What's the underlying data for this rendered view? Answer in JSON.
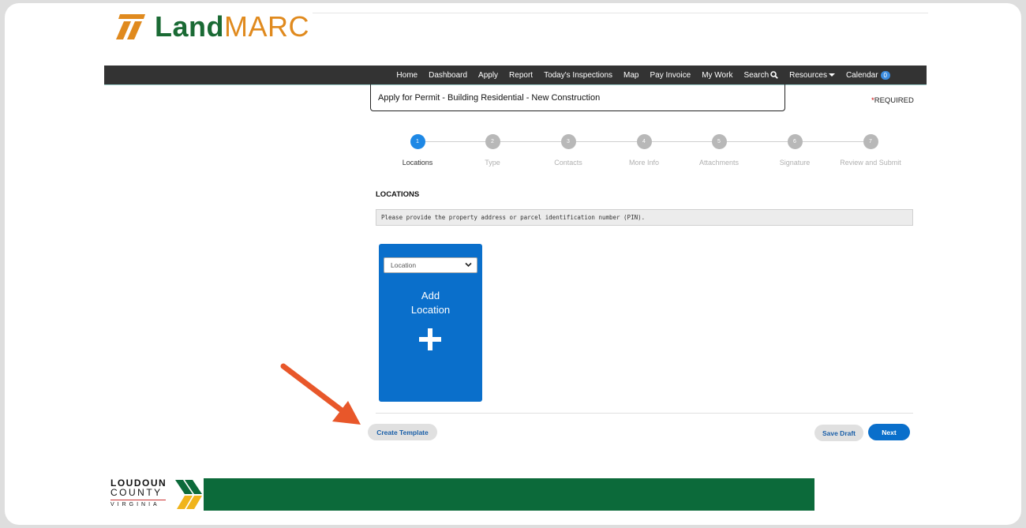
{
  "brand": {
    "name_part1": "Land",
    "name_part2": "MARC",
    "logo_icon": "landmarc-stripes-icon",
    "accent_green": "#1a6a34",
    "accent_orange": "#e08a1e"
  },
  "nav": {
    "items": [
      {
        "label": "Home"
      },
      {
        "label": "Dashboard"
      },
      {
        "label": "Apply"
      },
      {
        "label": "Report"
      },
      {
        "label": "Today's Inspections"
      },
      {
        "label": "Map"
      },
      {
        "label": "Pay Invoice"
      },
      {
        "label": "My Work"
      }
    ],
    "search_label": "Search",
    "search_icon": "search-icon",
    "resources_label": "Resources",
    "calendar_label": "Calendar",
    "calendar_count": "0"
  },
  "page": {
    "title": "Apply for Permit - Building Residential - New Construction",
    "required_star": "*",
    "required_label": "REQUIRED"
  },
  "steps": [
    {
      "number": "1",
      "label": "Locations",
      "state": "active"
    },
    {
      "number": "2",
      "label": "Type",
      "state": "inactive"
    },
    {
      "number": "3",
      "label": "Contacts",
      "state": "inactive"
    },
    {
      "number": "4",
      "label": "More Info",
      "state": "inactive"
    },
    {
      "number": "5",
      "label": "Attachments",
      "state": "inactive"
    },
    {
      "number": "6",
      "label": "Signature",
      "state": "inactive"
    },
    {
      "number": "7",
      "label": "Review and Submit",
      "state": "inactive"
    }
  ],
  "locations": {
    "section_title": "LOCATIONS",
    "info_text": "Please provide the property address or parcel identification number (PIN).",
    "card": {
      "select_value": "Location",
      "add_line1": "Add",
      "add_line2": "Location",
      "plus_icon": "plus-icon",
      "color": "#0a6fcb"
    }
  },
  "actions": {
    "create_template": "Create Template",
    "save_draft": "Save Draft",
    "next": "Next"
  },
  "annotation": {
    "arrow_icon": "pointer-arrow-icon",
    "color": "#e8572a"
  },
  "footer": {
    "line1": "LOUDOUN",
    "line2": "COUNTY",
    "line3": "VIRGINIA",
    "bar_color": "#0c6a3a"
  }
}
